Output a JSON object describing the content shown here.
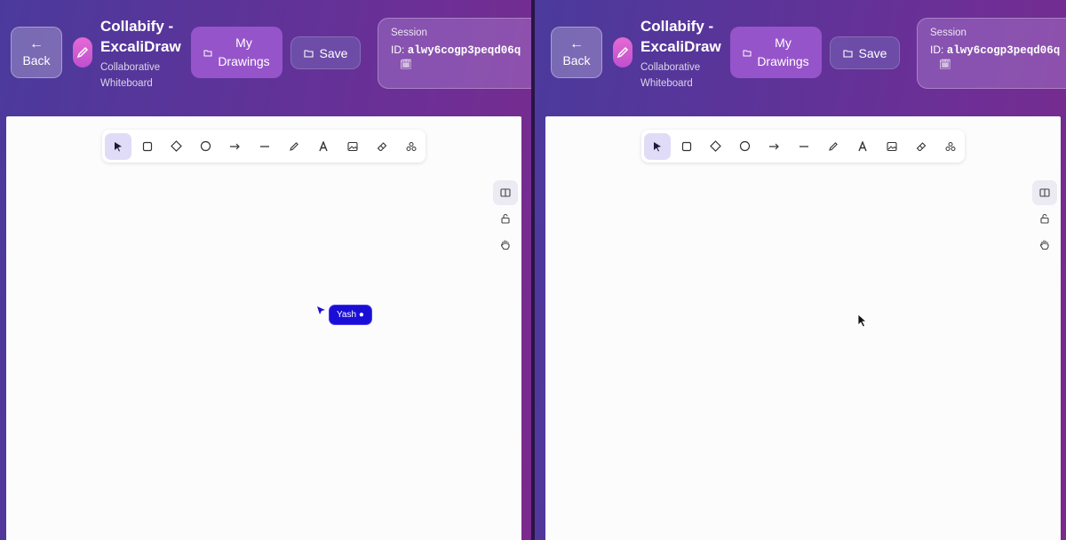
{
  "header": {
    "back_label": "Back",
    "back_arrow": "←",
    "title": "Collabify - ExcaliDraw",
    "subtitle": "Collaborative Whiteboard",
    "my_drawings_label": "My Drawings",
    "save_label": "Save",
    "session_label": "Session",
    "id_label": "ID:",
    "session_id": "alwy6cogp3peqd06q",
    "calendar_glyph": "🗓"
  },
  "toolbar": {
    "tools": [
      "selection-tool",
      "rectangle-tool",
      "diamond-tool",
      "ellipse-tool",
      "arrow-tool",
      "line-tool",
      "pencil-tool",
      "text-tool",
      "image-tool",
      "eraser-tool",
      "more-tools"
    ],
    "active": "selection-tool"
  },
  "side_tools": [
    "library-icon",
    "lock-icon",
    "hand-icon"
  ],
  "collaborator": {
    "name": "Yash",
    "color": "#1a0ed6"
  },
  "colors": {
    "accent": "#5b3499",
    "canvas": "#fcfcfd",
    "active_tool": "#e0dcf7"
  }
}
